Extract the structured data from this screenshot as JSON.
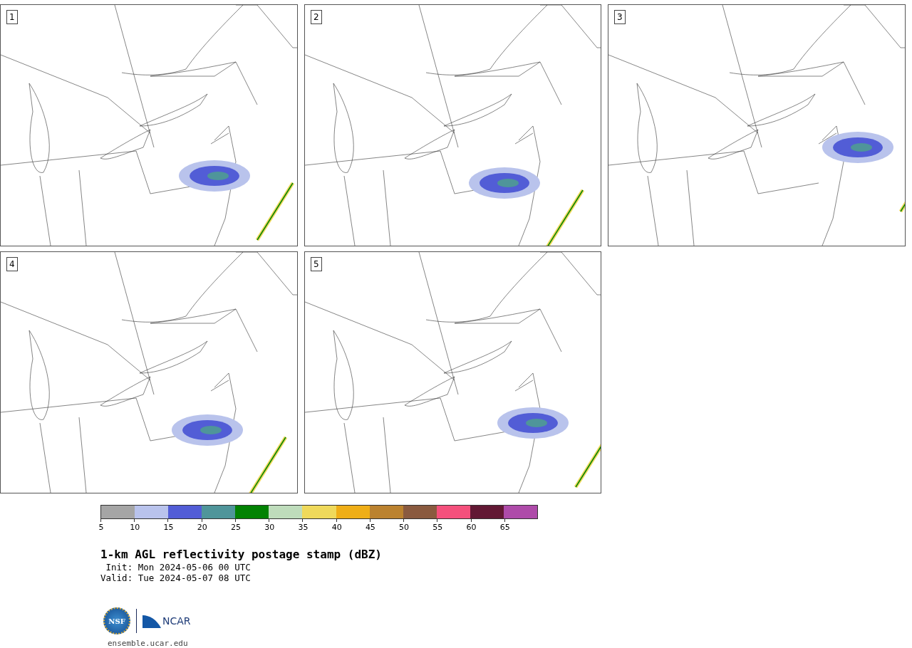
{
  "panels": [
    {
      "label": "1"
    },
    {
      "label": "2"
    },
    {
      "label": "3"
    },
    {
      "label": "4"
    },
    {
      "label": "5"
    }
  ],
  "colorbar": {
    "segments": [
      {
        "color": "#a5a5a5"
      },
      {
        "color": "#b9c3ec"
      },
      {
        "color": "#525dd6"
      },
      {
        "color": "#4f959a"
      },
      {
        "color": "#028203"
      },
      {
        "color": "#bedcbb"
      },
      {
        "color": "#efd95b"
      },
      {
        "color": "#efae17"
      },
      {
        "color": "#bb822f"
      },
      {
        "color": "#8a5a3f"
      },
      {
        "color": "#f4507c"
      },
      {
        "color": "#621834"
      },
      {
        "color": "#ae4ba9"
      }
    ],
    "ticks": [
      "5",
      "10",
      "15",
      "20",
      "25",
      "30",
      "35",
      "40",
      "45",
      "50",
      "55",
      "60",
      "65"
    ]
  },
  "title": "1-km AGL reflectivity postage stamp (dBZ)",
  "init": " Init: Mon 2024-05-06 00 UTC",
  "valid": "Valid: Tue 2024-05-07 08 UTC",
  "logo": {
    "left": "NSF",
    "right": "NCAR"
  },
  "url": "ensemble.ucar.edu"
}
